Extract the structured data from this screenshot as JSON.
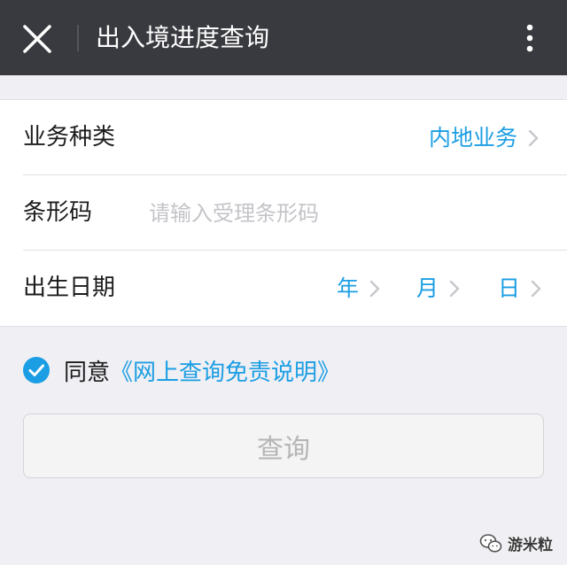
{
  "header": {
    "title": "出入境进度查询"
  },
  "icons": {
    "close": "close-icon",
    "more": "more-vertical-icon",
    "chevron": "chevron-right-icon",
    "agree_check": "check-circle-icon",
    "watermark_logo": "wechat-icon"
  },
  "form": {
    "business_type": {
      "label": "业务种类",
      "value": "内地业务"
    },
    "barcode": {
      "label": "条形码",
      "value": "",
      "placeholder": "请输入受理条形码"
    },
    "birth_date": {
      "label": "出生日期",
      "year": "年",
      "month": "月",
      "day": "日"
    }
  },
  "agreement": {
    "checked": true,
    "prefix": "同意",
    "link": "《网上查询免责说明》"
  },
  "query_button": {
    "label": "查询",
    "enabled": false
  },
  "watermark": {
    "text": "游米粒"
  },
  "colors": {
    "header_bg": "#393a3f",
    "accent": "#1b9ee3",
    "page_bg": "#efeff4",
    "placeholder": "#c4c4c9",
    "button_disabled_text": "#b5b5b5"
  }
}
